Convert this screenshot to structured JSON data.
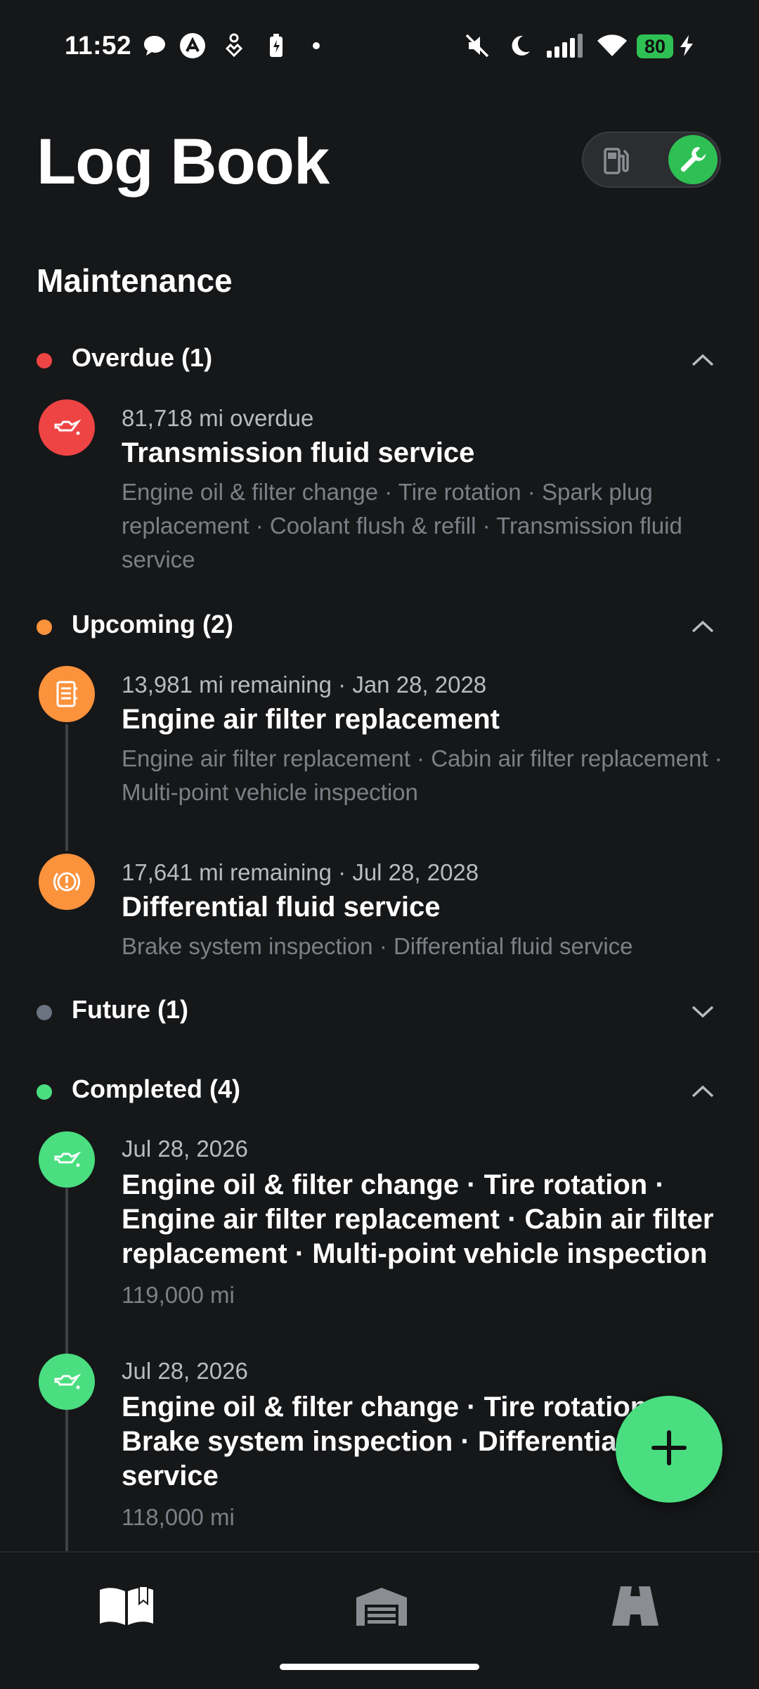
{
  "status_bar": {
    "time": "11:52",
    "battery": "80",
    "icons": [
      "chat-icon",
      "app-icon",
      "health-icon",
      "battery-saver-icon",
      "dot-icon",
      "mute-icon",
      "moon-icon",
      "signal-icon",
      "wifi-icon",
      "charging-icon"
    ]
  },
  "header": {
    "title": "Log Book",
    "toggle": {
      "left_icon": "fuel-pump-icon",
      "right_icon": "wrench-icon",
      "active": "maintenance"
    }
  },
  "section_title": "Maintenance",
  "colors": {
    "overdue": "#ef4444",
    "upcoming": "#fb923c",
    "future": "#6b7280",
    "completed": "#4ade80",
    "accent": "#2fc054"
  },
  "groups": {
    "overdue": {
      "label": "Overdue (1)",
      "chevron": "chevron-up-icon",
      "items": [
        {
          "icon": "oil-can-icon",
          "meta": "81,718 mi overdue",
          "title": "Transmission fluid service",
          "services": "Engine oil & filter change · Tire rotation · Spark plug replacement · Coolant flush & refill · Transmission fluid service"
        }
      ]
    },
    "upcoming": {
      "label": "Upcoming (2)",
      "chevron": "chevron-up-icon",
      "items": [
        {
          "icon": "air-filter-icon",
          "meta": "13,981 mi remaining · Jan 28, 2028",
          "title": "Engine air filter replacement",
          "services": "Engine air filter replacement · Cabin air filter replacement · Multi-point vehicle inspection"
        },
        {
          "icon": "brake-warning-icon",
          "meta": "17,641 mi remaining · Jul 28, 2028",
          "title": "Differential fluid service",
          "services": "Brake system inspection · Differential fluid service"
        }
      ]
    },
    "future": {
      "label": "Future (1)",
      "chevron": "chevron-down-icon"
    },
    "completed": {
      "label": "Completed (4)",
      "chevron": "chevron-up-icon",
      "items": [
        {
          "icon": "oil-can-icon",
          "meta": "Jul 28, 2026",
          "title": "Engine oil & filter change · Tire rotation · Engine air filter replacement · Cabin air filter replacement · Multi-point vehicle inspection",
          "mileage": "119,000 mi"
        },
        {
          "icon": "oil-can-icon",
          "meta": "Jul 28, 2026",
          "title": "Engine oil & filter change · Tire rotation · Brake system inspection · Differential fluid service",
          "mileage": "118,000 mi"
        }
      ]
    }
  },
  "fab": {
    "icon": "plus-icon"
  },
  "bottom_nav": [
    {
      "icon": "book-open-icon",
      "active": true
    },
    {
      "icon": "garage-icon",
      "active": false
    },
    {
      "icon": "road-icon",
      "active": false
    }
  ]
}
